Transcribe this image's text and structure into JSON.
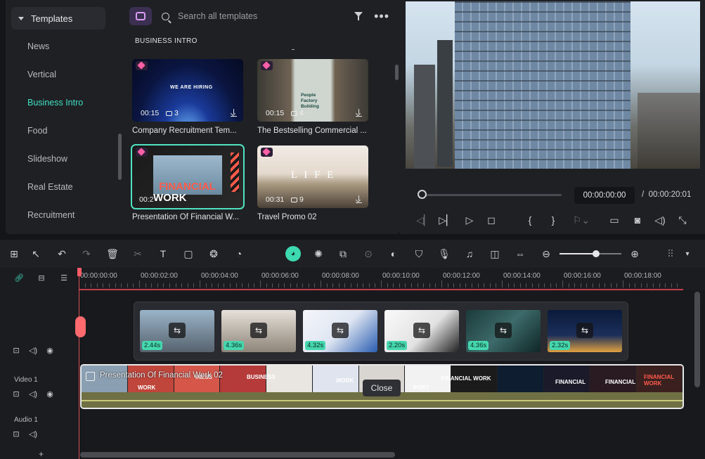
{
  "library": {
    "header": "Templates",
    "categories": [
      "News",
      "Vertical",
      "Business Intro",
      "Food",
      "Slideshow",
      "Real Estate",
      "Recruitment"
    ],
    "active_category": "Business Intro",
    "search_placeholder": "Search all templates",
    "section_title": "BUSINESS INTRO",
    "templates": [
      {
        "title": "Company Recruitment Tem...",
        "duration": "00:15",
        "layers": "3",
        "thumb_text": "WE ARE HIRING"
      },
      {
        "title": "The Bestselling Commercial ...",
        "duration": "00:15",
        "layers": "4",
        "thumb_text": "People Factory Building"
      },
      {
        "title": "Presentation Of Financial W...",
        "duration": "00:2",
        "layers": "",
        "thumb_text_1": "FINANCIAL",
        "thumb_text_2": "WORK"
      },
      {
        "title": "Travel Promo 02",
        "duration": "00:31",
        "layers": "9",
        "thumb_text": "L I F E"
      }
    ]
  },
  "preview": {
    "current_time": "00:00:00:00",
    "separator": "/",
    "total_time": "00:00:20:01"
  },
  "timeline": {
    "ruler_labels": [
      "00:00:00:00",
      "00:00:02:00",
      "00:00:04:00",
      "00:00:06:00",
      "00:00:08:00",
      "00:00:10:00",
      "00:00:12:00",
      "00:00:14:00",
      "00:00:16:00",
      "00:00:18:00"
    ],
    "group_clips": [
      "2.44s",
      "4.36s",
      "4.32s",
      "2.20s",
      "4.36s",
      "2.32s"
    ],
    "video_track_label": "Video 1",
    "audio_track_label": "Audio 1",
    "clip_title": "Presentation Of Financial Work 02",
    "close_label": "Close",
    "frame_texts": [
      "WORK",
      "INESS",
      "BUSINESS",
      "WORK",
      "PORT",
      "FINANCIAL WORK",
      "FINANCIAL",
      "FINANCIAL",
      "FINANCIAL WORK"
    ]
  },
  "colors": {
    "accent": "#3fe0c0",
    "playhead": "#d94d57",
    "background": "#141518",
    "panel": "#1f2024"
  }
}
